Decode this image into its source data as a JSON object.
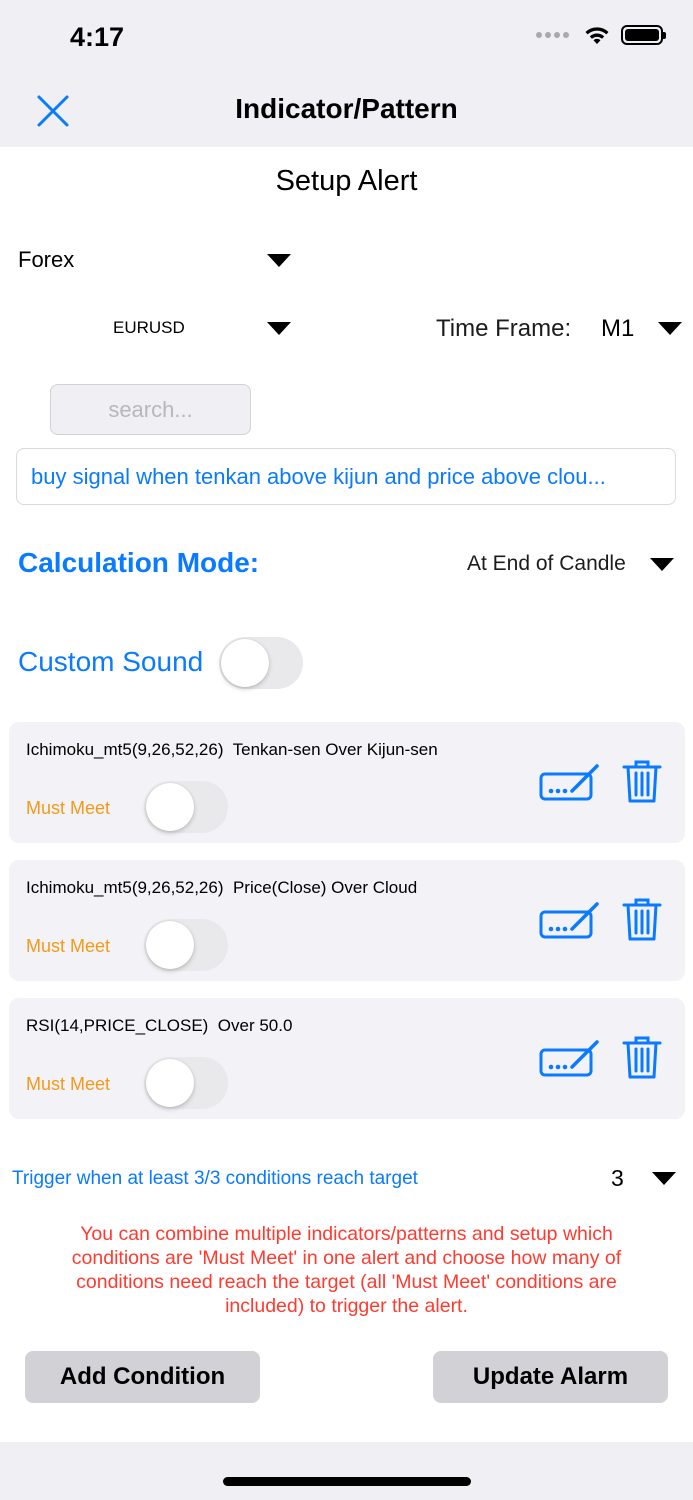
{
  "status_bar": {
    "time": "4:17"
  },
  "nav": {
    "title": "Indicator/Pattern",
    "close_icon": "close-icon"
  },
  "setup_title": "Setup Alert",
  "market": {
    "value": "Forex"
  },
  "pair": {
    "value": "EURUSD"
  },
  "time_frame": {
    "label": "Time Frame:",
    "value": "M1"
  },
  "search": {
    "placeholder": "search..."
  },
  "alert_name": "buy signal when tenkan above kijun and price above clou...",
  "calculation_mode": {
    "label": "Calculation Mode:",
    "value": "At End of Candle"
  },
  "custom_sound": {
    "label": "Custom Sound",
    "on": false
  },
  "conditions": [
    {
      "text": "Ichimoku_mt5(9,26,52,26)  Tenkan-sen Over Kijun-sen",
      "must_meet_label": "Must Meet",
      "must_meet": false
    },
    {
      "text": "Ichimoku_mt5(9,26,52,26)  Price(Close) Over Cloud",
      "must_meet_label": "Must Meet",
      "must_meet": false
    },
    {
      "text": "RSI(14,PRICE_CLOSE)  Over 50.0",
      "must_meet_label": "Must Meet",
      "must_meet": false
    }
  ],
  "trigger": {
    "label": "Trigger when at least 3/3 conditions reach target",
    "value": "3"
  },
  "note": "You can combine multiple indicators/patterns and setup which conditions are 'Must Meet' in one alert and choose how many of conditions need reach the target (all 'Must Meet' conditions are included) to trigger the alert.",
  "buttons": {
    "add_condition": "Add Condition",
    "update_alarm": "Update Alarm"
  },
  "colors": {
    "accent": "#0a7aff",
    "must_meet": "#f29a18",
    "note": "#ff3b30",
    "header_bg": "#efeff4"
  }
}
